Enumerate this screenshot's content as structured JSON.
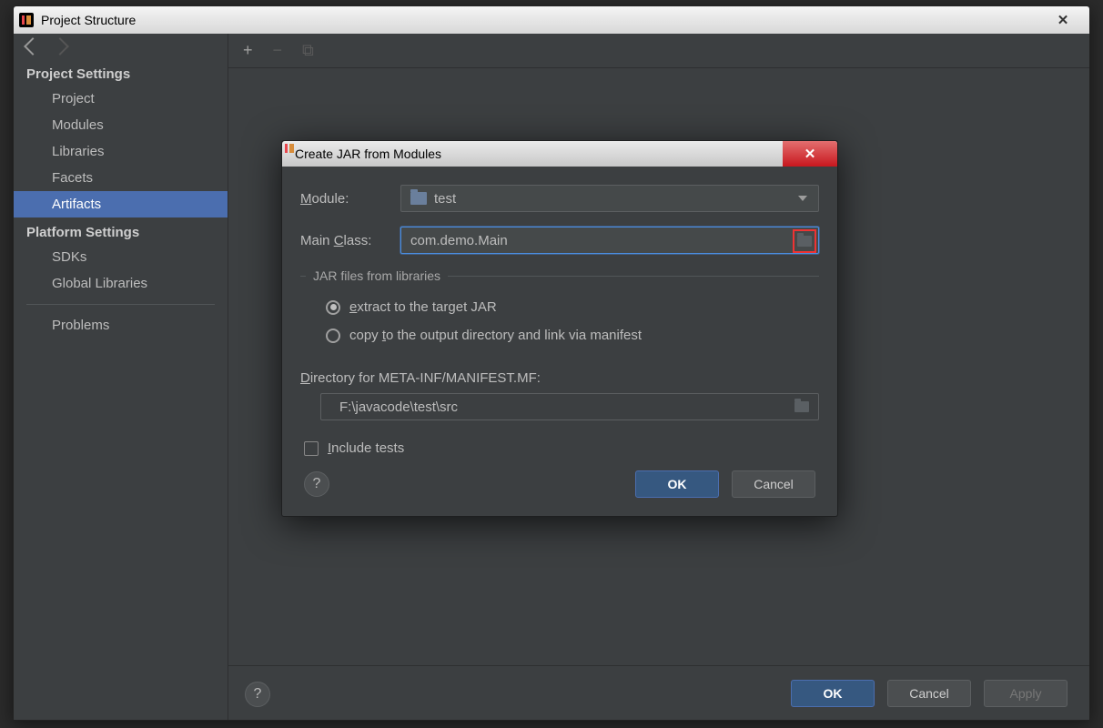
{
  "window": {
    "title": "Project Structure"
  },
  "sidebar": {
    "section1": "Project Settings",
    "items1": [
      "Project",
      "Modules",
      "Libraries",
      "Facets",
      "Artifacts"
    ],
    "section2": "Platform Settings",
    "items2": [
      "SDKs",
      "Global Libraries"
    ],
    "problems": "Problems"
  },
  "dialog": {
    "title": "Create JAR from Modules",
    "module_label": "Module:",
    "module_value": "test",
    "mainclass_label": "Main Class:",
    "mainclass_value": "com.demo.Main",
    "jar_legend": "JAR files from libraries",
    "radio_extract": "extract to the target JAR",
    "radio_copy": "copy to the output directory and link via manifest",
    "dir_label": "Directory for META-INF/MANIFEST.MF:",
    "dir_value": "F:\\javacode\\test\\src",
    "include_tests": "Include tests",
    "ok": "OK",
    "cancel": "Cancel"
  },
  "bottom": {
    "ok": "OK",
    "cancel": "Cancel",
    "apply": "Apply"
  }
}
